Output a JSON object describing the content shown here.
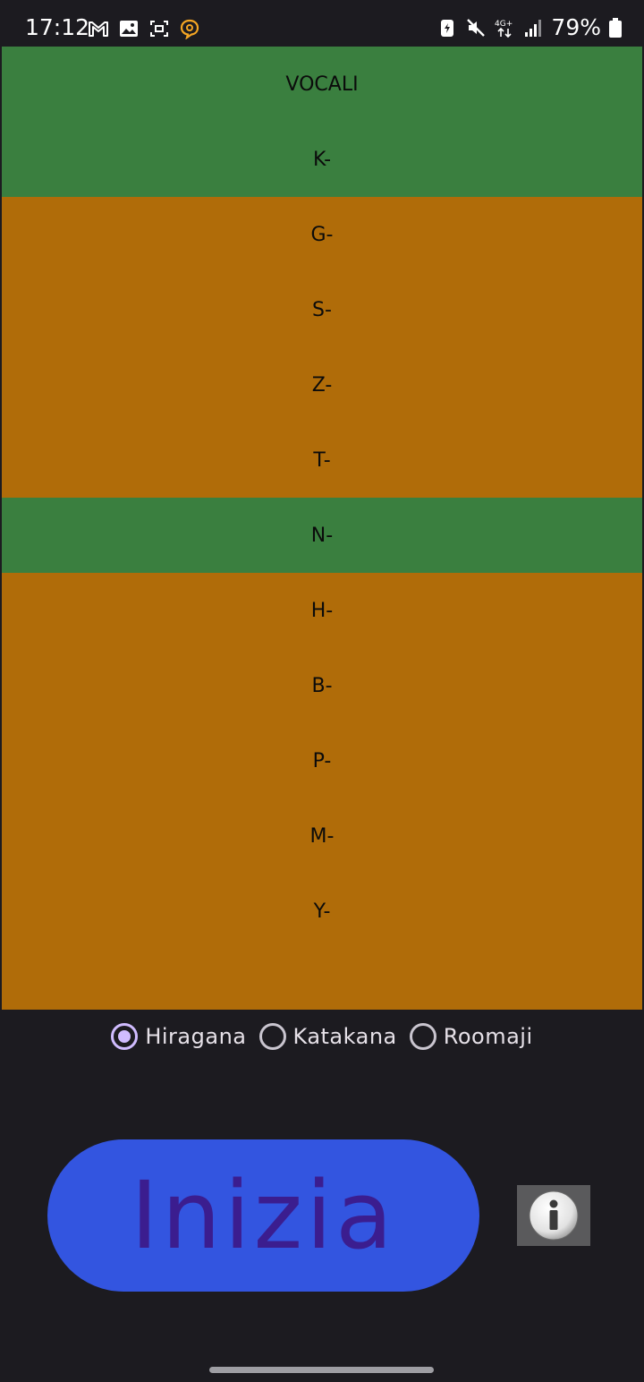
{
  "status_bar": {
    "time": "17:12",
    "battery_percent": "79%",
    "network_label": "4G+",
    "left_icons": [
      "gmail-icon",
      "gallery-icon",
      "screen-capture-icon",
      "chat-bubble-icon"
    ],
    "right_icons": [
      "battery-saver-icon",
      "mute-icon",
      "network-4g-icon",
      "signal-icon",
      "battery-icon"
    ]
  },
  "groups": [
    {
      "label": "VOCALI",
      "selected": true
    },
    {
      "label": "K-",
      "selected": true
    },
    {
      "label": "G-",
      "selected": false
    },
    {
      "label": "S-",
      "selected": false
    },
    {
      "label": "Z-",
      "selected": false
    },
    {
      "label": "T-",
      "selected": false
    },
    {
      "label": "N-",
      "selected": true
    },
    {
      "label": "H-",
      "selected": false
    },
    {
      "label": "B-",
      "selected": false
    },
    {
      "label": "P-",
      "selected": false
    },
    {
      "label": "M-",
      "selected": false
    },
    {
      "label": "Y-",
      "selected": false
    }
  ],
  "colors": {
    "selected": "#3a7f3f",
    "unselected": "#b06c09",
    "background": "#1c1b20",
    "button": "#3355e0",
    "button_text": "#3b1d8f",
    "radio_checked": "#d0bcff"
  },
  "script_options": {
    "selected": "Hiragana",
    "options": [
      "Hiragana",
      "Katakana",
      "Roomaji"
    ]
  },
  "start_button": {
    "label": "Inizia"
  },
  "info_button": {
    "icon": "info-icon"
  }
}
